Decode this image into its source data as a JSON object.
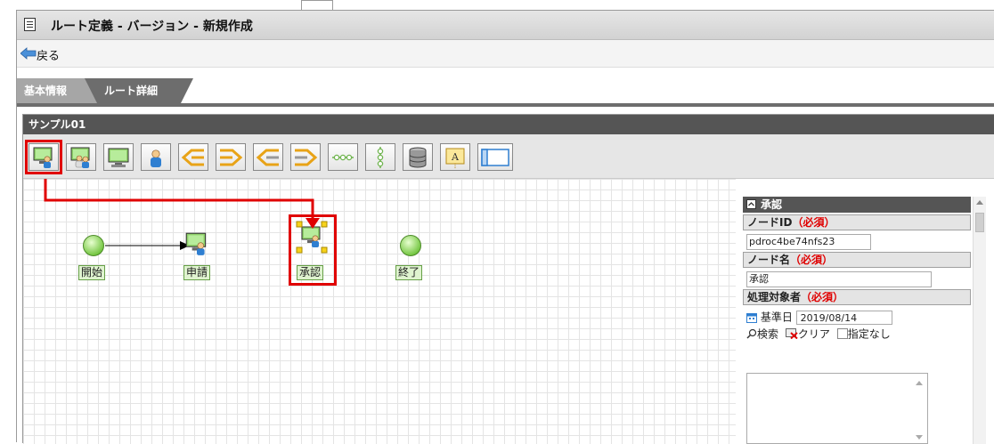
{
  "window": {
    "title": "ルート定義 - バージョン - 新規作成"
  },
  "nav": {
    "back_label": "戻る"
  },
  "tabs": [
    {
      "label": "基本情報"
    },
    {
      "label": "ルート詳細"
    }
  ],
  "panel": {
    "title": "サンプル01"
  },
  "toolbar": {
    "tools": [
      "user-node-icon",
      "multi-user-node-icon",
      "system-node-icon",
      "person-node-icon",
      "branch-start-icon",
      "branch-end-icon",
      "branch-start-icon",
      "branch-end-icon",
      "horizontal-line-icon",
      "vertical-line-icon",
      "database-icon",
      "text-label-icon",
      "frame-icon"
    ],
    "selected_index": 0
  },
  "canvas": {
    "nodes": [
      {
        "label": "開始",
        "type": "start"
      },
      {
        "label": "申請",
        "type": "user"
      },
      {
        "label": "承認",
        "type": "user",
        "selected": true
      },
      {
        "label": "終了",
        "type": "end"
      }
    ]
  },
  "properties": {
    "section_title": "承認",
    "node_id": {
      "label": "ノードID",
      "required": "（必須）",
      "value": "pdroc4be74nfs23"
    },
    "node_name": {
      "label": "ノード名",
      "required": "（必須）",
      "value": "承認"
    },
    "assignee": {
      "label": "処理対象者",
      "required": "（必須）"
    },
    "base_date": {
      "label": "基準日",
      "value": "2019/08/14"
    },
    "actions": {
      "search": "検索",
      "clear": "クリア",
      "unspecified": "指定なし"
    }
  },
  "colors": {
    "highlight": "#e00000",
    "panel_header": "#555555",
    "node_green": "#7ed321"
  }
}
